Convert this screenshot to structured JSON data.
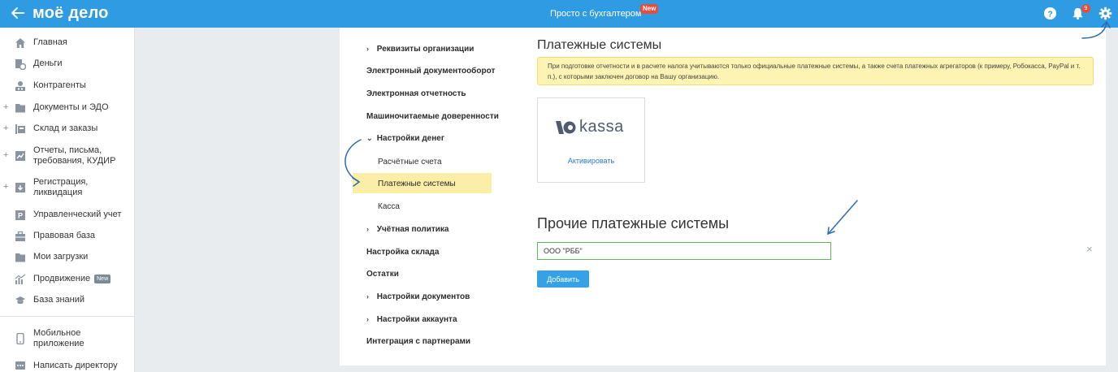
{
  "topbar": {
    "logo": "моё дело",
    "center_title": "Просто с бухгалтером",
    "new_badge": "New",
    "notification_count": "9"
  },
  "sidebar": {
    "items": [
      {
        "label": "Главная",
        "icon": "home-icon",
        "expandable": false
      },
      {
        "label": "Деньги",
        "icon": "money-icon",
        "expandable": false
      },
      {
        "label": "Контрагенты",
        "icon": "contractors-icon",
        "expandable": false
      },
      {
        "label": "Документы и ЭДО",
        "icon": "folder-icon",
        "expandable": true
      },
      {
        "label": "Склад и заказы",
        "icon": "warehouse-icon",
        "expandable": true
      },
      {
        "label": "Отчеты, письма, требования, КУДИР",
        "icon": "reports-icon",
        "expandable": true
      },
      {
        "label": "Регистрация, ликвидация",
        "icon": "registration-icon",
        "expandable": true
      },
      {
        "label": "Управленческий учет",
        "icon": "management-icon",
        "expandable": false
      },
      {
        "label": "Правовая база",
        "icon": "briefcase-icon",
        "expandable": false
      },
      {
        "label": "Мои загрузки",
        "icon": "downloads-icon",
        "expandable": false
      },
      {
        "label": "Продвижение",
        "icon": "promotion-icon",
        "expandable": false,
        "badge": "New"
      },
      {
        "label": "База знаний",
        "icon": "knowledge-icon",
        "expandable": false
      }
    ],
    "bottom_items": [
      {
        "label": "Мобильное приложение",
        "icon": "mobile-icon"
      },
      {
        "label": "Написать директору",
        "icon": "message-icon"
      }
    ]
  },
  "settings_menu": {
    "items": [
      {
        "label": "Реквизиты организации",
        "chevron": "›",
        "level": 0
      },
      {
        "label": "Электронный документооборот",
        "chevron": "",
        "level": 0
      },
      {
        "label": "Электронная отчетность",
        "chevron": "",
        "level": 0
      },
      {
        "label": "Машиночитаемые доверенности",
        "chevron": "",
        "level": 0
      },
      {
        "label": "Настройки денег",
        "chevron": "⌄",
        "level": 0
      },
      {
        "label": "Расчётные счета",
        "chevron": "",
        "level": 1
      },
      {
        "label": "Платежные системы",
        "chevron": "",
        "level": 1,
        "active": true
      },
      {
        "label": "Касса",
        "chevron": "",
        "level": 1
      },
      {
        "label": "Учётная политика",
        "chevron": "›",
        "level": 0
      },
      {
        "label": "Настройка склада",
        "chevron": "",
        "level": 0
      },
      {
        "label": "Остатки",
        "chevron": "",
        "level": 0
      },
      {
        "label": "Настройки документов",
        "chevron": "›",
        "level": 0
      },
      {
        "label": "Настройки аккаунта",
        "chevron": "›",
        "level": 0
      },
      {
        "label": "Интеграция с партнерами",
        "chevron": "",
        "level": 0
      }
    ]
  },
  "content": {
    "title": "Платежные системы",
    "notice": "При подготовке отчетности и в расчете налога учитываются только официальные платежные системы, а также счета платежных агрегаторов (к примеру, Робокасса, PayPal и т. п.), с которыми заключен договор на Вашу организацию.",
    "kassa_name": "kassa",
    "activate_label": "Активировать",
    "other_title": "Прочие платежные системы",
    "input_value": "ООО \"РББ\"",
    "clear_label": "×",
    "add_button": "Добавить"
  },
  "colors": {
    "topbar": "#2f9be3",
    "active_menu": "#fbeea6",
    "notice_bg": "#fdf3b2",
    "button": "#35a2e8",
    "input_border": "#5cb85c"
  }
}
